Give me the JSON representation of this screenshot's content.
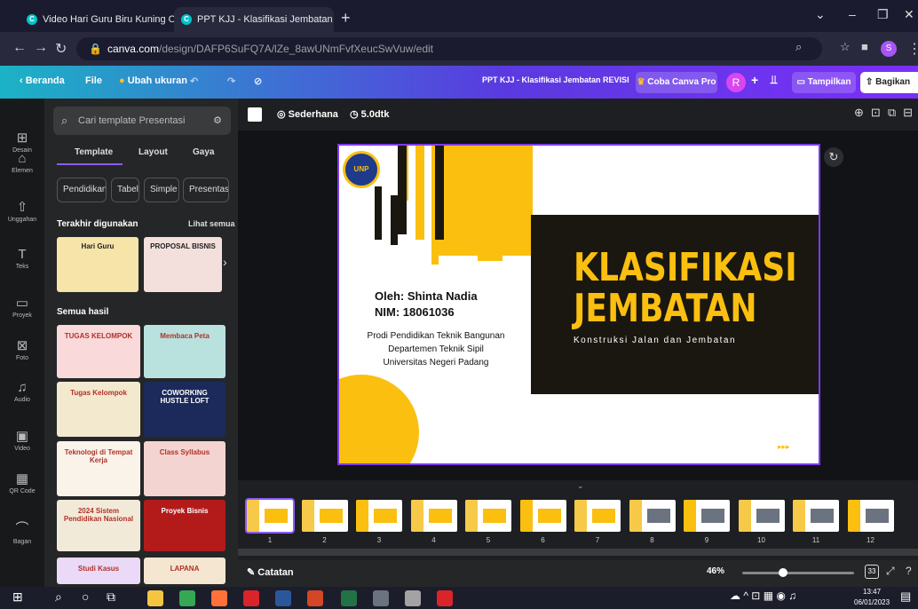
{
  "browser": {
    "tabs": [
      {
        "title": "Video Hari Guru Biru Kuning Org"
      },
      {
        "title": "PPT KJJ - Klasifikasi Jembatan RE"
      }
    ],
    "url_domain": "canva.com",
    "url_path": "/design/DAFP6SuFQ7A/lZe_8awUNmFvfXeucSwVuw/edit"
  },
  "header": {
    "back": "Beranda",
    "file": "File",
    "resize": "Ubah ukuran",
    "doc_title": "PPT KJJ - Klasifikasi Jembatan REVISI",
    "try_pro": "Coba Canva Pro",
    "avatar": "R",
    "present": "Tampilkan",
    "share": "Bagikan"
  },
  "rail": [
    {
      "icon": "design-icon",
      "glyph": "⊞",
      "label": "Desain"
    },
    {
      "icon": "elements-icon",
      "glyph": "⌂",
      "label": "Elemen"
    },
    {
      "icon": "upload-icon",
      "glyph": "⇧",
      "label": "Unggahan"
    },
    {
      "icon": "text-icon",
      "glyph": "T",
      "label": "Teks"
    },
    {
      "icon": "folder-icon",
      "glyph": "▭",
      "label": "Proyek"
    },
    {
      "icon": "photo-icon",
      "glyph": "⊠",
      "label": "Foto"
    },
    {
      "icon": "audio-icon",
      "glyph": "♫",
      "label": "Audio"
    },
    {
      "icon": "video-icon",
      "glyph": "▣",
      "label": "Video"
    },
    {
      "icon": "qr-icon",
      "glyph": "▦",
      "label": "QR Code"
    },
    {
      "icon": "chart-icon",
      "glyph": "⌒",
      "label": "Bagan"
    }
  ],
  "panel": {
    "search_placeholder": "Cari template Presentasi",
    "tabs": [
      "Template",
      "Layout",
      "Gaya"
    ],
    "chips": [
      "Pendidikan",
      "Tabel",
      "Simple",
      "Presentasi"
    ],
    "recent_heading": "Terakhir digunakan",
    "see_all": "Lihat semua",
    "all_heading": "Semua hasil",
    "recent_thumbs": [
      {
        "title": "Hari Guru",
        "bg": "#f6e4a8"
      },
      {
        "title": "PROPOSAL BISNIS",
        "bg": "#f3e0dc"
      }
    ],
    "results": [
      {
        "title": "TUGAS KELOMPOK",
        "bg": "#f9d9d9"
      },
      {
        "title": "Membaca Peta",
        "bg": "#b9e2df"
      },
      {
        "title": "Tugas Kelompok",
        "bg": "#f3e9cf"
      },
      {
        "title": "COWORKING HUSTLE LOFT",
        "bg": "#1b2a5a"
      },
      {
        "title": "Teknologi di Tempat Kerja",
        "bg": "#f9f3ea"
      },
      {
        "title": "Class Syllabus",
        "bg": "#f3d4d0"
      },
      {
        "title": "2024 Sistem Pendidikan Nasional",
        "bg": "#f2ead8"
      },
      {
        "title": "Proyek Bisnis",
        "bg": "#b31b1b"
      },
      {
        "title": "Studi Kasus",
        "bg": "#ead9f7"
      },
      {
        "title": "LAPANA",
        "bg": "#f4e6d0"
      }
    ]
  },
  "toolbar": {
    "transition": "Sederhana",
    "duration": "5.0dtk"
  },
  "slide": {
    "title_line1": "KLASIFIKASI",
    "title_line2": "JEMBATAN",
    "subtitle": "Konstruksi Jalan dan Jembatan",
    "author": "Oleh: Shinta Nadia",
    "nim": "NIM: 18061036",
    "dept1": "Prodi Pendidikan Teknik Bangunan",
    "dept2": "Departemen Teknik Sipil",
    "dept3": "Universitas Negeri Padang",
    "logo_text": "UNP",
    "accent": "#fbbf0f",
    "dark": "#1a1711"
  },
  "filmstrip": {
    "pages": [
      "1",
      "2",
      "3",
      "4",
      "5",
      "6",
      "7",
      "8",
      "9",
      "10",
      "11",
      "12"
    ]
  },
  "footer": {
    "notes": "Catatan",
    "zoom": "46%",
    "page_count": "33"
  },
  "taskbar": {
    "time": "13:47",
    "date": "06/01/2023"
  }
}
